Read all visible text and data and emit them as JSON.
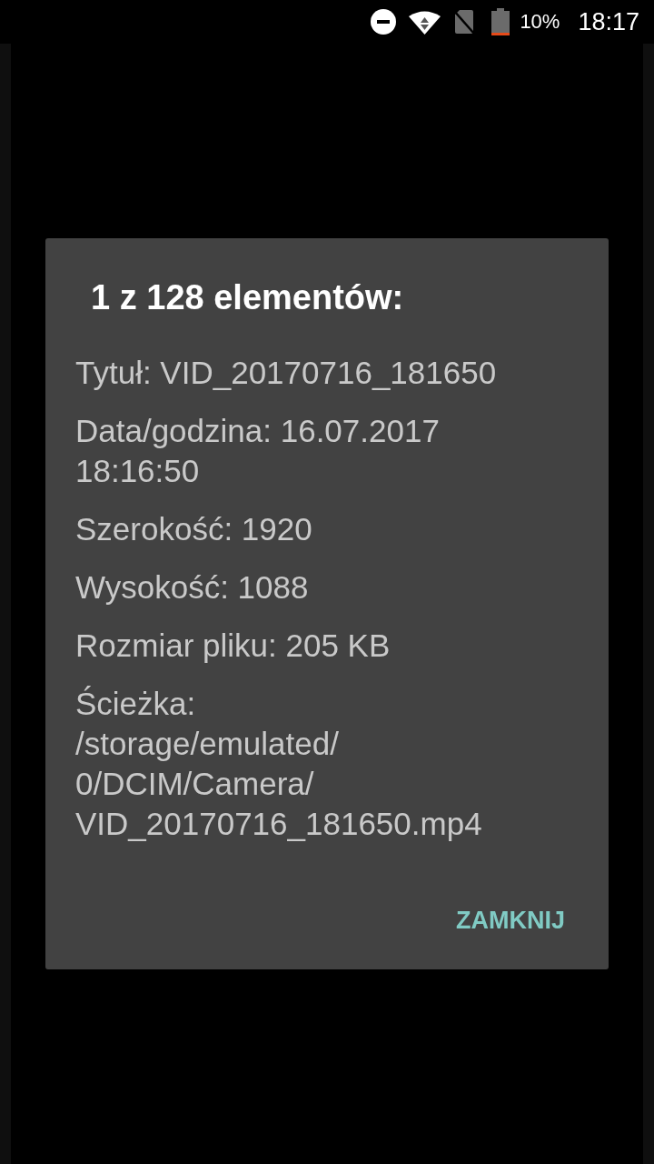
{
  "status_bar": {
    "battery_text": "10%",
    "time": "18:17"
  },
  "dialog": {
    "title": "1 z 128 elementów:",
    "details": [
      "Tytuł: VID_20170716_181650",
      "Data/godzina: 16.07.2017\n18:16:50",
      "Szerokość: 1920",
      "Wysokość: 1088",
      "Rozmiar pliku: 205 KB",
      "Ścieżka:\n/storage/emulated/\n0/DCIM/Camera/\nVID_20170716_181650.mp4"
    ],
    "buttons": [
      "ZAMKNIJ"
    ]
  }
}
